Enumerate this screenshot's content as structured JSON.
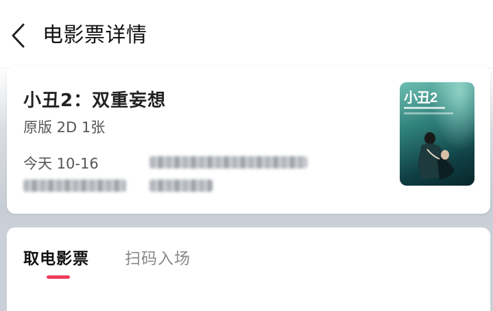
{
  "header": {
    "title": "电影票详情",
    "back_icon": "chevron-left-icon"
  },
  "ticket": {
    "movie_title": "小丑2：双重妄想",
    "ticket_type": "原版 2D 1张",
    "show_date": "今天 10-16"
  },
  "poster": {
    "title_text": "小丑2"
  },
  "tabs": [
    {
      "label": "取电影票",
      "active": true
    },
    {
      "label": "扫码入场",
      "active": false
    }
  ],
  "colors": {
    "accent": "#ee3b5b",
    "title_text": "#111111",
    "secondary_text": "#555555",
    "inactive_tab": "#888888"
  }
}
